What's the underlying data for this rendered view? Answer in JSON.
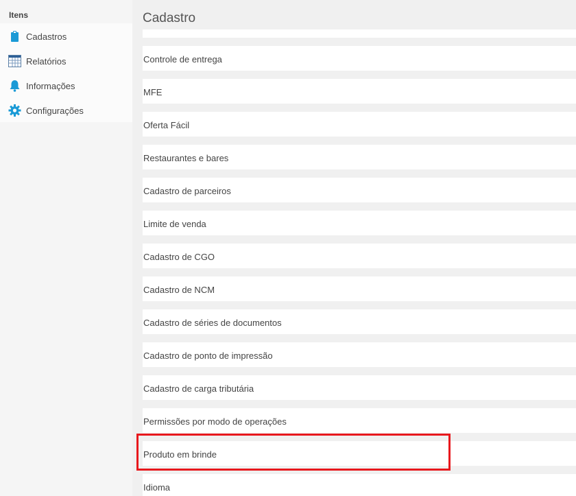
{
  "sidebar": {
    "title": "Itens",
    "items": [
      {
        "label": "Cadastros",
        "icon": "clipboard-icon"
      },
      {
        "label": "Relatórios",
        "icon": "table-icon"
      },
      {
        "label": "Informações",
        "icon": "bell-icon"
      },
      {
        "label": "Configurações",
        "icon": "gear-icon"
      }
    ]
  },
  "main": {
    "title": "Cadastro",
    "items": [
      "Controle de entrega",
      "MFE",
      "Oferta Fácil",
      "Restaurantes e bares",
      "Cadastro de parceiros",
      "Limite de venda",
      "Cadastro de CGO",
      "Cadastro de NCM",
      "Cadastro de séries de documentos",
      "Cadastro de ponto de impressão",
      "Cadastro de carga tributária",
      "Permissões por modo de operações",
      "Produto em brinde",
      "Idioma"
    ],
    "highlighted_item": "Produto em brinde"
  },
  "colors": {
    "accent": "#1a9ad6",
    "highlight": "#e8181d",
    "background": "#f0f0f0"
  }
}
